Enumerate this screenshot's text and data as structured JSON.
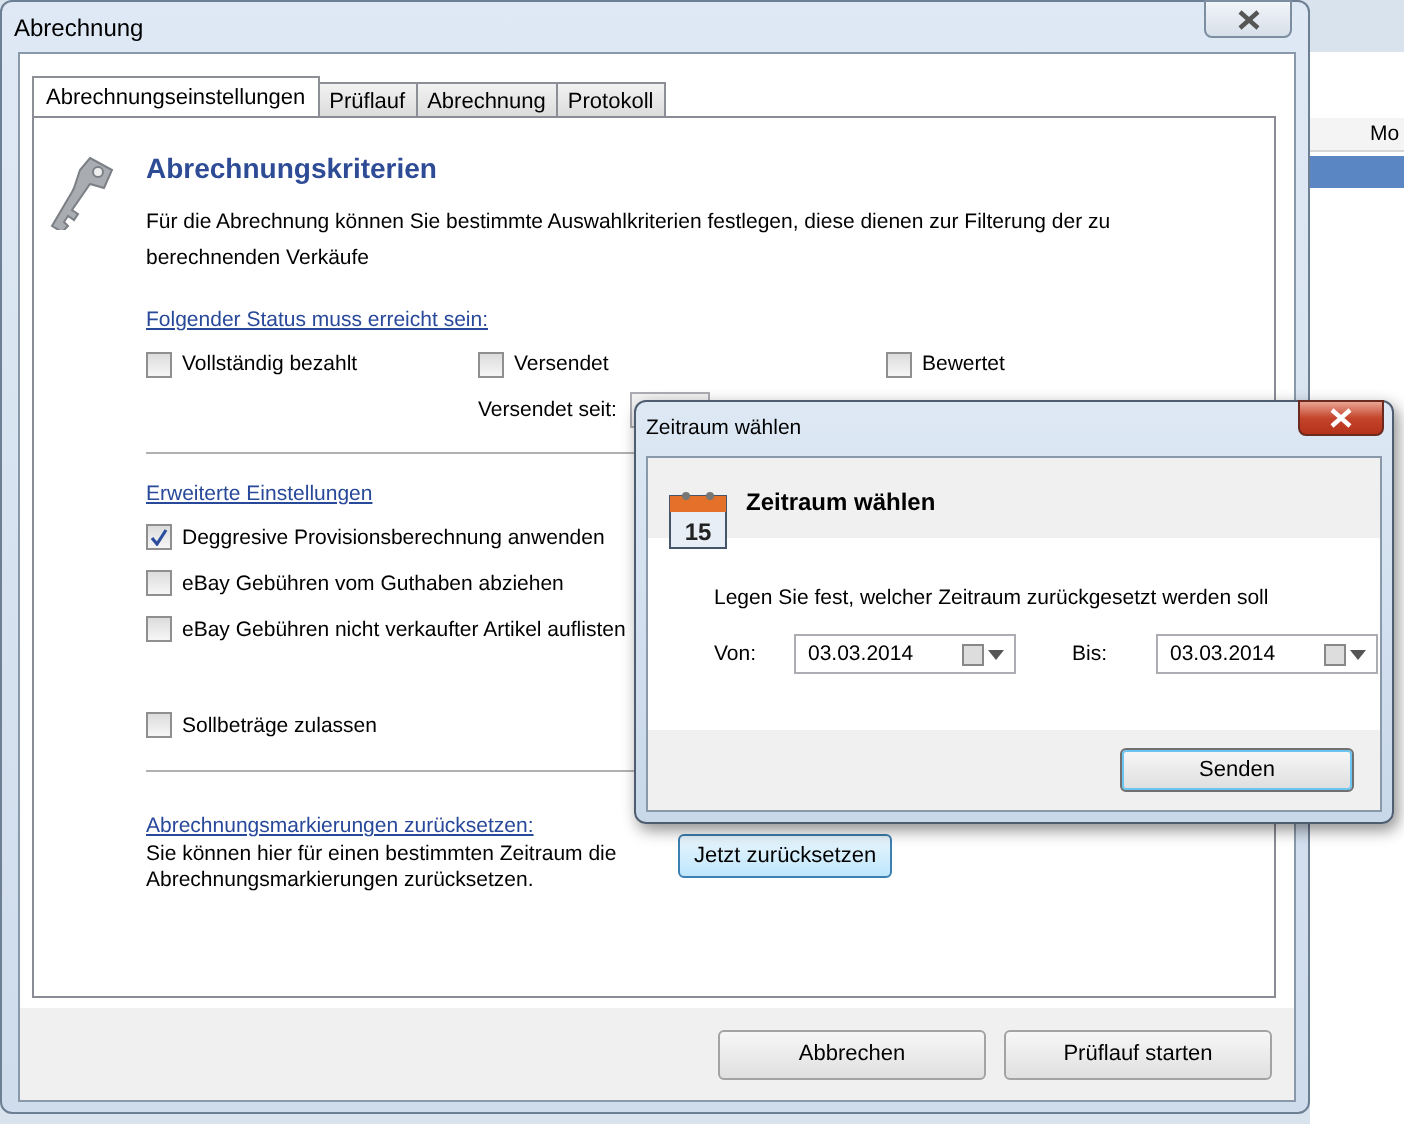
{
  "window": {
    "title": "Abrechnung"
  },
  "tabs": [
    {
      "label": "Abrechnungseinstellungen",
      "selected": true
    },
    {
      "label": "Prüflauf",
      "selected": false
    },
    {
      "label": "Abrechnung",
      "selected": false
    },
    {
      "label": "Protokoll",
      "selected": false
    }
  ],
  "panel": {
    "heading": "Abrechnungskriterien",
    "description": "Für die Abrechnung können Sie bestimmte Auswahlkriterien festlegen, diese dienen zur Filterung der zu berechnenden Verkäufe",
    "status_section": {
      "title": "Folgender Status muss erreicht sein:",
      "options": [
        {
          "label": "Vollständig bezahlt",
          "checked": false
        },
        {
          "label": "Versendet",
          "checked": false
        },
        {
          "label": "Bewertet",
          "checked": false
        }
      ],
      "shipped_since_label": "Versendet seit:"
    },
    "advanced_section": {
      "title": "Erweiterte Einstellungen",
      "options": [
        {
          "label": "Deggresive Provisionsberechnung anwenden",
          "checked": true
        },
        {
          "label": "eBay Gebühren vom Guthaben abziehen",
          "checked": false
        },
        {
          "label": "eBay Gebühren nicht verkaufter Artikel auflisten",
          "checked": false
        },
        {
          "label": "Sollbeträge zulassen",
          "checked": false
        }
      ]
    },
    "reset_section": {
      "title": "Abrechnungsmarkierungen zurücksetzen:",
      "description": "Sie können hier für einen bestimmten Zeitraum die Abrechnungsmarkierungen zurücksetzen.",
      "button": "Jetzt zurücksetzen"
    }
  },
  "buttons": [
    "Abbrechen",
    "Prüflauf starten"
  ],
  "background_window": {
    "column_header": "Mo"
  },
  "dialog": {
    "title": "Zeitraum wählen",
    "heading": "Zeitraum wählen",
    "calendar_day": "15",
    "prompt": "Legen Sie fest, welcher Zeitraum zurückgesetzt werden soll",
    "from_label": "Von:",
    "from_value": "03.03.2014",
    "to_label": "Bis:",
    "to_value": "03.03.2014",
    "button": "Senden"
  }
}
